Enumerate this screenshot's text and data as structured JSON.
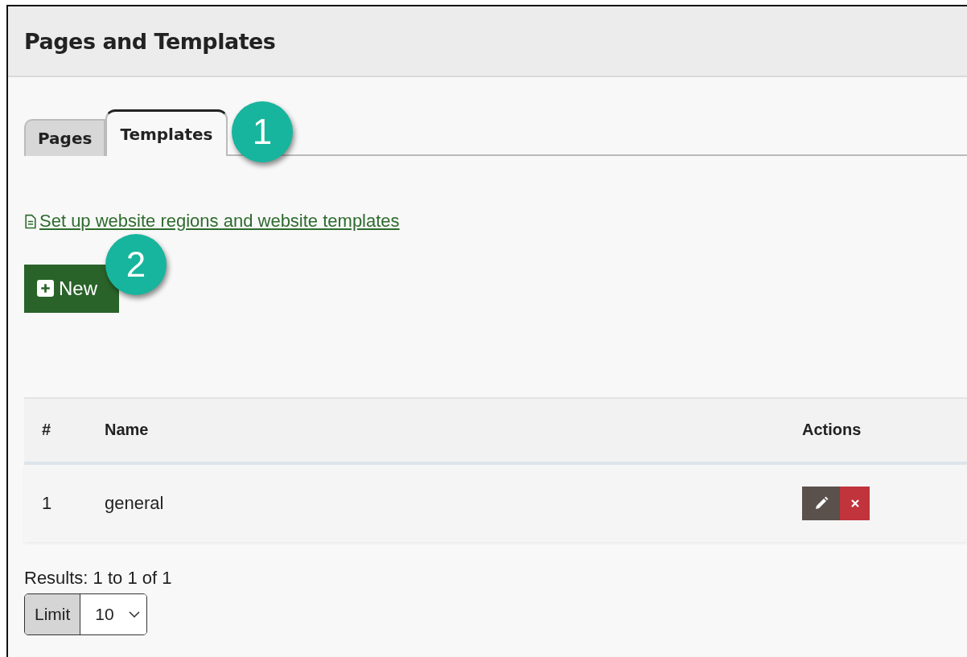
{
  "header": {
    "title": "Pages and Templates"
  },
  "tabs": [
    {
      "label": "Pages",
      "selected": false
    },
    {
      "label": "Templates",
      "selected": true
    }
  ],
  "link": {
    "text": "Set up website regions and website templates"
  },
  "new_button": {
    "label": "New"
  },
  "callouts": [
    "1",
    "2"
  ],
  "table": {
    "columns": [
      "#",
      "Name",
      "Actions"
    ],
    "rows": [
      {
        "number": "1",
        "name": "general"
      }
    ]
  },
  "results": "Results: 1 to 1 of 1",
  "limit": {
    "label": "Limit",
    "value": "10"
  }
}
